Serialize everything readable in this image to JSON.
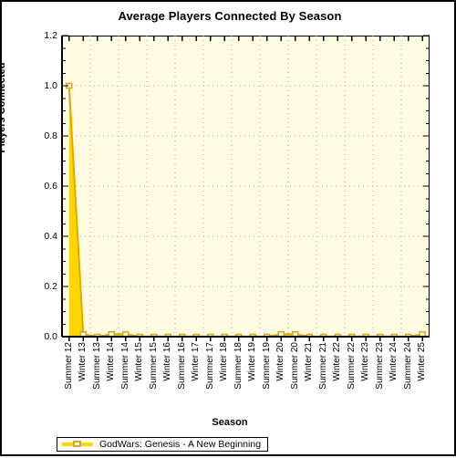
{
  "chart_data": {
    "type": "area",
    "title": "Average Players Connected By Season",
    "xlabel": "Season",
    "ylabel": "Players Connected",
    "ylim": [
      0.0,
      1.2
    ],
    "yticks": [
      "0.0",
      "0.2",
      "0.4",
      "0.6",
      "0.8",
      "1.0",
      "1.2"
    ],
    "ytick_values": [
      0.0,
      0.2,
      0.4,
      0.6,
      0.8,
      1.0,
      1.2
    ],
    "grid": true,
    "legend_position": "bottom-left",
    "categories": [
      "Summer 12",
      "Winter 13",
      "Summer 13",
      "Winter 14",
      "Summer 14",
      "Winter 15",
      "Summer 15",
      "Winter 16",
      "Summer 16",
      "Winter 17",
      "Summer 17",
      "Winter 18",
      "Summer 18",
      "Winter 19",
      "Summer 19",
      "Winter 20",
      "Summer 20",
      "Winter 21",
      "Summer 21",
      "Winter 22",
      "Summer 22",
      "Winter 23",
      "Summer 23",
      "Winter 24",
      "Summer 24",
      "Winter 25"
    ],
    "series": [
      {
        "name": "GodWars: Genesis - A New Beginning",
        "color": "#FFD700",
        "line_color": "#DAA520",
        "values": [
          1.0,
          0.01,
          0.0,
          0.01,
          0.01,
          0.0,
          0.0,
          0.0,
          0.0,
          0.0,
          0.0,
          0.0,
          0.0,
          0.0,
          0.0,
          0.01,
          0.01,
          0.0,
          0.0,
          0.0,
          0.0,
          0.0,
          0.0,
          0.0,
          0.0,
          0.01
        ]
      }
    ]
  },
  "chart": {
    "title": "Average Players Connected By Season",
    "xlabel": "Season",
    "ylabel": "Players Connected",
    "legend_label": "GodWars: Genesis - A New Beginning",
    "plot_bg": "#fdfce0",
    "series_fill": "#FFD700",
    "series_stroke": "#DAA520",
    "grid_color": "#b0b0b0",
    "axis_color": "#000000"
  }
}
